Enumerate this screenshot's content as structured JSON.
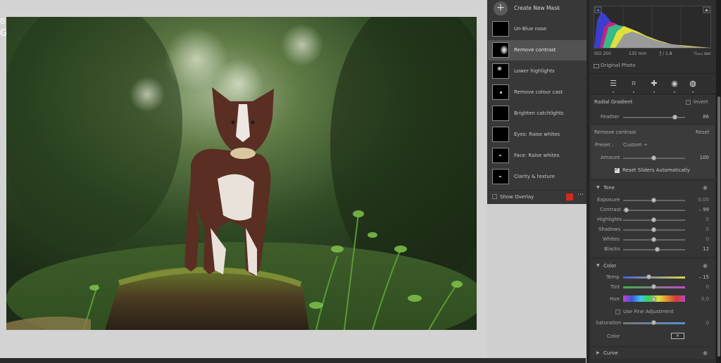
{
  "canvas": {
    "partial_top": "0",
    "partial_text": "GM)"
  },
  "mask_panel": {
    "create_label": "Create New Mask",
    "items": [
      {
        "label": "Un-Blue nose",
        "selected": false
      },
      {
        "label": "Remove contrast",
        "selected": true
      },
      {
        "label": "Lower highlights",
        "selected": false
      },
      {
        "label": "Remove colour cast",
        "selected": false
      },
      {
        "label": "Brighten catchlights",
        "selected": false
      },
      {
        "label": "Eyes: Raise whites",
        "selected": false
      },
      {
        "label": "Face: Raise whites",
        "selected": false
      },
      {
        "label": "Clarity & texture",
        "selected": false
      }
    ],
    "show_overlay_label": "Show Overlay",
    "overlay_color": "#d12a1c",
    "more_icon": "⋯"
  },
  "histogram": {
    "iso": "ISO 250",
    "focal": "135 mm",
    "aperture": "ƒ / 1.8",
    "shutter": "¹⁄₁₆₀₀ sec",
    "original_photo": "Original Photo"
  },
  "tools": [
    "edit-sliders-icon",
    "crop-icon",
    "healing-icon",
    "red-eye-icon",
    "masking-icon"
  ],
  "radial": {
    "title": "Radial Gradient",
    "invert_label": "Invert",
    "feather_label": "Feather",
    "feather_value": "86",
    "feather_level": 0.86
  },
  "mask_settings": {
    "title": "Remove contrast",
    "reset_label": "Reset",
    "preset_label": "Preset :",
    "preset_value": "Custom",
    "preset_arrow": "÷",
    "amount_label": "Amount",
    "amount_value": "100",
    "amount_level": 0.5,
    "reset_sliders_label": "Reset Sliders Automatically",
    "reset_sliders_checked": true
  },
  "tone": {
    "title": "Tone",
    "rows": [
      {
        "label": "Exposure",
        "value": "0,00",
        "level": 0.5
      },
      {
        "label": "Contrast",
        "value": "– 99",
        "level": 0.005
      },
      {
        "label": "Highlights",
        "value": "0",
        "level": 0.5
      },
      {
        "label": "Shadows",
        "value": "0",
        "level": 0.5
      },
      {
        "label": "Whites",
        "value": "0",
        "level": 0.5
      },
      {
        "label": "Blacks",
        "value": "12",
        "level": 0.56
      }
    ]
  },
  "color": {
    "title": "Color",
    "temp_label": "Temp",
    "temp_value": "– 15",
    "temp_level": 0.425,
    "tint_label": "Tint",
    "tint_value": "0",
    "tint_level": 0.5,
    "hue_label": "Hue",
    "hue_value": "0,0",
    "hue_level": 0.5,
    "fine_label": "Use Fine Adjustment",
    "saturation_label": "Saturation",
    "saturation_value": "0",
    "saturation_level": 0.5,
    "color_label": "Color"
  },
  "curve": {
    "title": "Curve"
  }
}
